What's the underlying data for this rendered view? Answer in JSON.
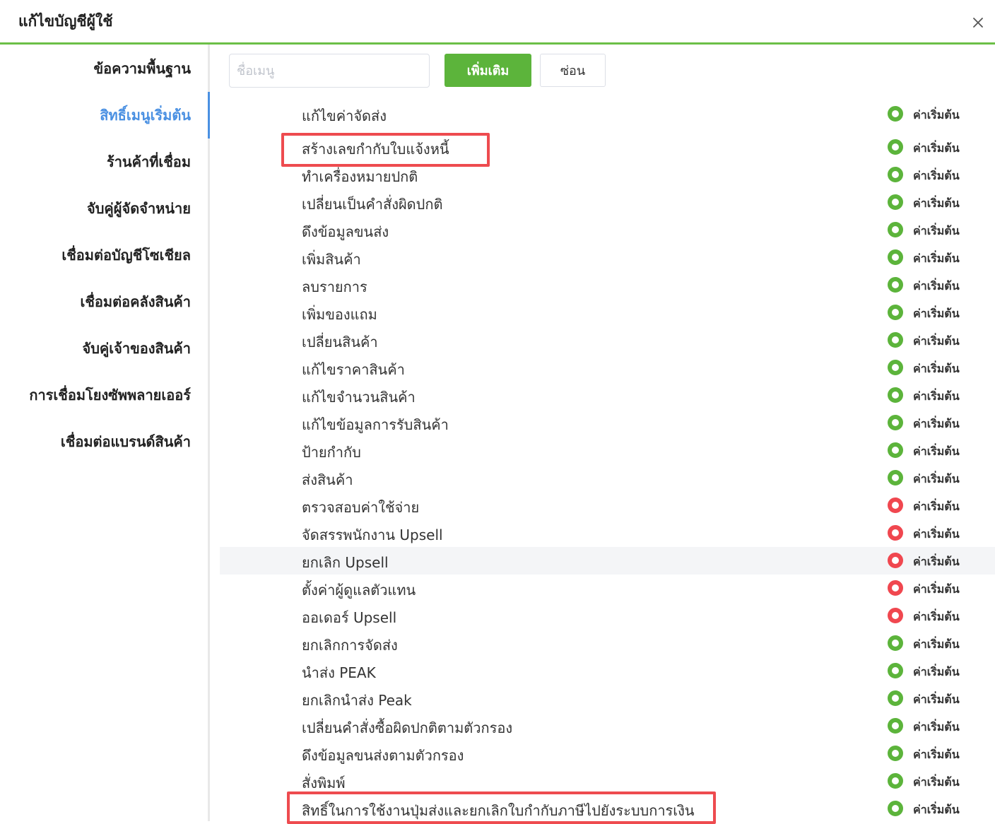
{
  "dialog": {
    "title": "แก้ไขบัญชีผู้ใช้"
  },
  "sidebar": {
    "items": [
      {
        "label": "ข้อความพื้นฐาน"
      },
      {
        "label": "สิทธิ์เมนูเริ่มต้น"
      },
      {
        "label": "ร้านค้าที่เชื่อม"
      },
      {
        "label": "จับคู่ผู้จัดจำหน่าย"
      },
      {
        "label": "เชื่อมต่อบัญชีโซเชียล"
      },
      {
        "label": "เชื่อมต่อคลังสินค้า"
      },
      {
        "label": "จับคู่เจ้าของสินค้า"
      },
      {
        "label": "การเชื่อมโยงซัพพลายเออร์"
      },
      {
        "label": "เชื่อมต่อแบรนด์สินค้า"
      }
    ],
    "active_index": 1
  },
  "toolbar": {
    "search_placeholder": "ชื่อเมนู",
    "search_value": "",
    "add_label": "เพิ่มเติม",
    "hide_label": "ซ่อน"
  },
  "colors": {
    "accent_green": "#5cb43b",
    "active_blue": "#4a90e2",
    "off_red": "#f0474f",
    "highlight_red": "#ee4b4f"
  },
  "permissions": [
    {
      "name": "แก้ไขค่าจัดส่ง",
      "status": "on",
      "status_label": "ค่าเริ่มต้น"
    },
    {
      "name": "สร้างเลขกำกับใบแจ้งหนี้",
      "status": "on",
      "status_label": "ค่าเริ่มต้น"
    },
    {
      "name": "ทำเครื่องหมายปกติ",
      "status": "on",
      "status_label": "ค่าเริ่มต้น"
    },
    {
      "name": "เปลี่ยนเป็นคำสั่งผิดปกติ",
      "status": "on",
      "status_label": "ค่าเริ่มต้น"
    },
    {
      "name": "ดึงข้อมูลขนส่ง",
      "status": "on",
      "status_label": "ค่าเริ่มต้น"
    },
    {
      "name": "เพิ่มสินค้า",
      "status": "on",
      "status_label": "ค่าเริ่มต้น"
    },
    {
      "name": "ลบรายการ",
      "status": "on",
      "status_label": "ค่าเริ่มต้น"
    },
    {
      "name": "เพิ่มของแถม",
      "status": "on",
      "status_label": "ค่าเริ่มต้น"
    },
    {
      "name": "เปลี่ยนสินค้า",
      "status": "on",
      "status_label": "ค่าเริ่มต้น"
    },
    {
      "name": "แก้ไขราคาสินค้า",
      "status": "on",
      "status_label": "ค่าเริ่มต้น"
    },
    {
      "name": "แก้ไขจำนวนสินค้า",
      "status": "on",
      "status_label": "ค่าเริ่มต้น"
    },
    {
      "name": "แก้ไขข้อมูลการรับสินค้า",
      "status": "on",
      "status_label": "ค่าเริ่มต้น"
    },
    {
      "name": "ป้ายกำกับ",
      "status": "on",
      "status_label": "ค่าเริ่มต้น"
    },
    {
      "name": "ส่งสินค้า",
      "status": "on",
      "status_label": "ค่าเริ่มต้น"
    },
    {
      "name": "ตรวจสอบค่าใช้จ่าย",
      "status": "off",
      "status_label": "ค่าเริ่มต้น"
    },
    {
      "name": "จัดสรรพนักงาน Upsell",
      "status": "off",
      "status_label": "ค่าเริ่มต้น"
    },
    {
      "name": "ยกเลิก Upsell",
      "status": "off",
      "status_label": "ค่าเริ่มต้น",
      "hovered": true
    },
    {
      "name": "ตั้งค่าผู้ดูแลตัวแทน",
      "status": "off",
      "status_label": "ค่าเริ่มต้น"
    },
    {
      "name": "ออเดอร์ Upsell",
      "status": "off",
      "status_label": "ค่าเริ่มต้น"
    },
    {
      "name": "ยกเลิกการจัดส่ง",
      "status": "on",
      "status_label": "ค่าเริ่มต้น"
    },
    {
      "name": "นำส่ง PEAK",
      "status": "on",
      "status_label": "ค่าเริ่มต้น"
    },
    {
      "name": "ยกเลิกนำส่ง Peak",
      "status": "on",
      "status_label": "ค่าเริ่มต้น"
    },
    {
      "name": "เปลี่ยนคำสั่งซื้อผิดปกติตามตัวกรอง",
      "status": "on",
      "status_label": "ค่าเริ่มต้น"
    },
    {
      "name": "ดึงข้อมูลขนส่งตามตัวกรอง",
      "status": "on",
      "status_label": "ค่าเริ่มต้น"
    },
    {
      "name": "สั่งพิมพ์",
      "status": "on",
      "status_label": "ค่าเริ่มต้น"
    },
    {
      "name": "สิทธิ์ในการใช้งานปุ่มส่งและยกเลิกใบกำกับภาษีไปยังระบบการเงิน",
      "status": "on",
      "status_label": "ค่าเริ่มต้น"
    }
  ]
}
